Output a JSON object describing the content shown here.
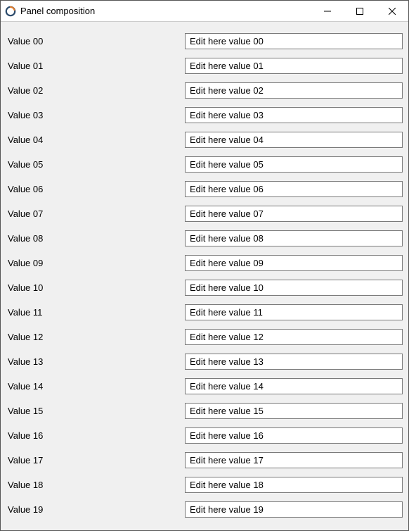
{
  "window": {
    "title": "Panel composition"
  },
  "rows": [
    {
      "label": "Value 00",
      "value": "Edit here value 00"
    },
    {
      "label": "Value 01",
      "value": "Edit here value 01"
    },
    {
      "label": "Value 02",
      "value": "Edit here value 02"
    },
    {
      "label": "Value 03",
      "value": "Edit here value 03"
    },
    {
      "label": "Value 04",
      "value": "Edit here value 04"
    },
    {
      "label": "Value 05",
      "value": "Edit here value 05"
    },
    {
      "label": "Value 06",
      "value": "Edit here value 06"
    },
    {
      "label": "Value 07",
      "value": "Edit here value 07"
    },
    {
      "label": "Value 08",
      "value": "Edit here value 08"
    },
    {
      "label": "Value 09",
      "value": "Edit here value 09"
    },
    {
      "label": "Value 10",
      "value": "Edit here value 10"
    },
    {
      "label": "Value 11",
      "value": "Edit here value 11"
    },
    {
      "label": "Value 12",
      "value": "Edit here value 12"
    },
    {
      "label": "Value 13",
      "value": "Edit here value 13"
    },
    {
      "label": "Value 14",
      "value": "Edit here value 14"
    },
    {
      "label": "Value 15",
      "value": "Edit here value 15"
    },
    {
      "label": "Value 16",
      "value": "Edit here value 16"
    },
    {
      "label": "Value 17",
      "value": "Edit here value 17"
    },
    {
      "label": "Value 18",
      "value": "Edit here value 18"
    },
    {
      "label": "Value 19",
      "value": "Edit here value 19"
    }
  ]
}
